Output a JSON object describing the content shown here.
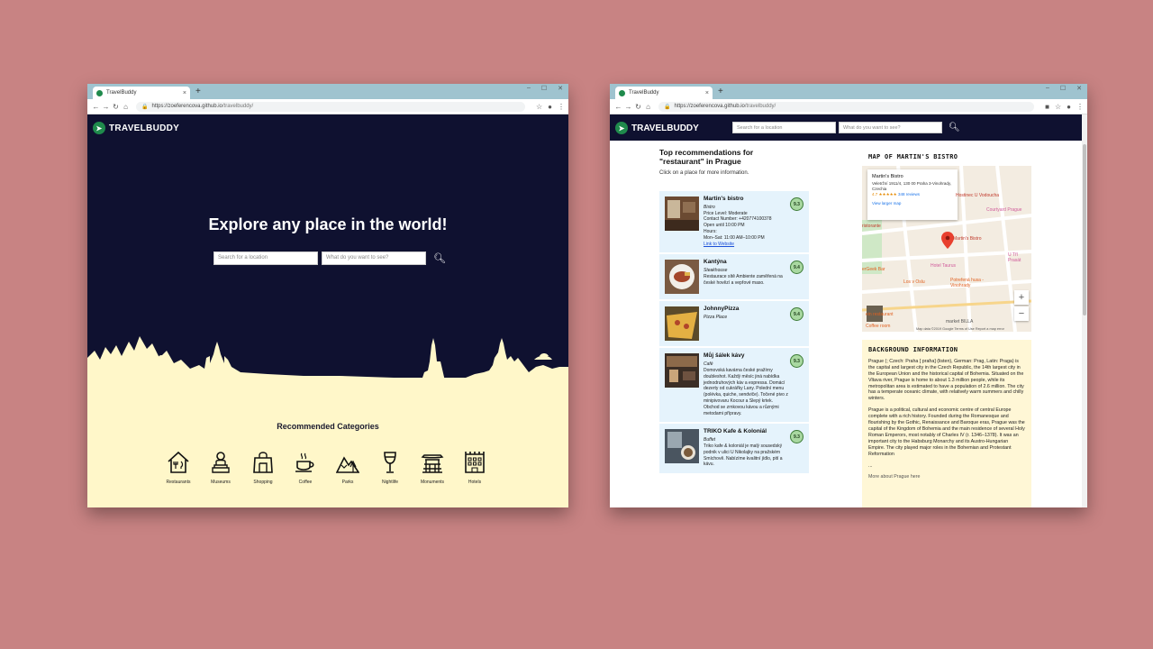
{
  "browser": {
    "tab_title": "TravelBuddy",
    "tab_close": "×",
    "new_tab": "+",
    "url_host": "https://zoeferencova.github.io",
    "url_path": "/travelbuddy/",
    "window_controls": [
      "–",
      "☐",
      "✕"
    ]
  },
  "home": {
    "logo_text": "TRAVELBUDDY",
    "hero_title": "Explore any place in the world!",
    "search_location_placeholder": "Search for a location",
    "search_what_placeholder": "What do you want to see?",
    "recommended_title": "Recommended Categories",
    "categories": [
      {
        "label": "Restaurants",
        "icon": "restaurant-icon"
      },
      {
        "label": "Museums",
        "icon": "museum-icon"
      },
      {
        "label": "Shopping",
        "icon": "shopping-icon"
      },
      {
        "label": "Coffee",
        "icon": "coffee-icon"
      },
      {
        "label": "Parks",
        "icon": "park-icon"
      },
      {
        "label": "Nightlife",
        "icon": "nightlife-icon"
      },
      {
        "label": "Monuments",
        "icon": "monument-icon"
      },
      {
        "label": "Hotels",
        "icon": "hotel-icon"
      }
    ]
  },
  "results": {
    "logo_text": "TRAVELBUDDY",
    "search_location_placeholder": "Search for a location",
    "search_what_placeholder": "What do you want to see?",
    "title_line1": "Top recommendations for",
    "title_line2": "\"restaurant\" in Prague",
    "subtitle": "Click on a place for more information.",
    "items": [
      {
        "name": "Martin's bistro",
        "category": "Bistro",
        "rating": "9.3",
        "price": "Price Level: Moderate",
        "contact": "Contact Number: +420774100378",
        "open": "Open until 10:00 PM",
        "hours_label": "Hours:",
        "hours": "Mon–Sat: 11:00 AM–10:00 PM",
        "link": "Link to Website"
      },
      {
        "name": "Kantýna",
        "category": "Steakhouse",
        "rating": "9.4",
        "desc": "Restaurace sítě Ambiente zaměřená na české hovězí a vepřové maso."
      },
      {
        "name": "JohnnyPizza",
        "category": "Pizza Place",
        "rating": "9.4"
      },
      {
        "name": "Můj šálek kávy",
        "category": "Café",
        "rating": "9.3",
        "desc": "Domovská kavárna české pražírny doubleshot. Každý měsíc jiná nabídka jednodruhových káv a espressa. Domácí dezerty od cukrářky Lany. Polední menu (polévka, quiche, sendviče). Točené pivo z minipivovaru Kocour a Slepý krtek. Obchod se zrnkovou kávou a různými metodami přípravy."
      },
      {
        "name": "TRIKO Kafe & Koloniál",
        "category": "Buffet",
        "rating": "9.3",
        "desc": "Triko kafe & koloniál je malý sousedský podnik v ulici U Nikolajky na pražském Smíchově. Nabízíme kvalitní jídlo, pití a kávu."
      }
    ],
    "map_title": "MAP OF MARTIN'S BISTRO",
    "map_card": {
      "title": "Martin's Bistro",
      "address": "Veletržní 1911/4, 130 00 Praha 3-Vinohrady, Czechia",
      "rating": "4.7 ★★★★★",
      "reviews": "348 reviews",
      "link": "View larger map"
    },
    "map_labels": [
      "Hostinec U Vodoucha",
      "Courtyard Prague",
      "Martin's Bistro",
      "Hotel Taurus",
      "Potrefená husa - Vinohrady",
      "Los v Oslu",
      "market BILLA",
      "ein restaurant",
      "Coffee room",
      "U Tří Prasát",
      "ristorante",
      "erGeek Bar"
    ],
    "map_footer": "Map data ©2019 Google   Terms of Use   Report a map error",
    "bg_title": "BACKGROUND INFORMATION",
    "bg_p1": "Prague (; Czech: Praha [ praɦa] (listen), German: Prag, Latin: Praga) is the capital and largest city in the Czech Republic, the 14th largest city in the European Union and the historical capital of Bohemia. Situated on the Vltava river, Prague is home to about 1.3 million people, while its metropolitan area is estimated to have a population of 2.6 million. The city has a temperate oceanic climate, with relatively warm summers and chilly winters.",
    "bg_p2": "Prague is a political, cultural and economic centre of central Europe complete with a rich history. Founded during the Romanesque and flourishing by the Gothic, Renaissance and Baroque eras, Prague was the capital of the Kingdom of Bohemia and the main residence of several Holy Roman Emperors, most notably of Charles IV (r. 1346–1378). It was an important city to the Habsburg Monarchy and its Austro-Hungarian Empire. The city played major roles in the Bohemian and Protestant Reformation",
    "bg_ellipsis": "...",
    "bg_more": "More about Prague here"
  },
  "colors": {
    "navy": "#0f1130",
    "cream": "#fff7c9",
    "green": "#1f8a4c",
    "card_blue": "#e5f3fc",
    "background": "#c88383"
  }
}
